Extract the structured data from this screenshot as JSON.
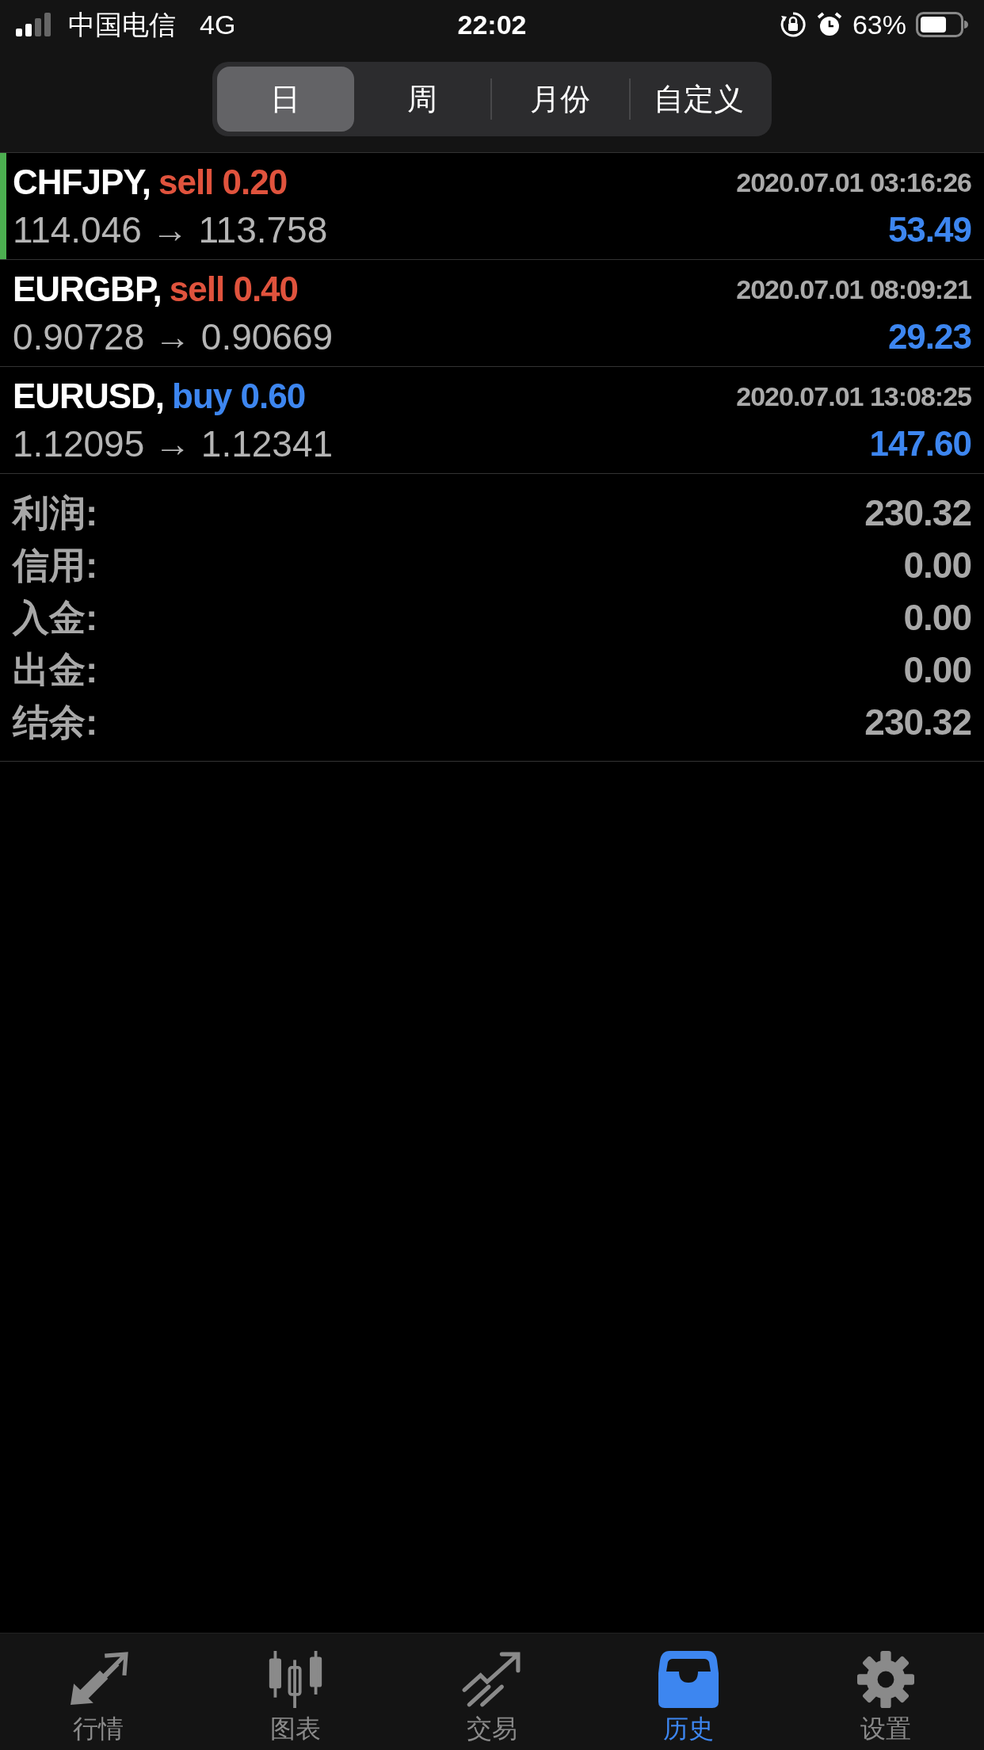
{
  "status_bar": {
    "carrier": "中国电信",
    "network": "4G",
    "time": "22:02",
    "battery": "63%"
  },
  "periods": [
    {
      "label": "日",
      "selected": true
    },
    {
      "label": "周",
      "selected": false
    },
    {
      "label": "月份",
      "selected": false
    },
    {
      "label": "自定义",
      "selected": false
    }
  ],
  "deals": [
    {
      "symbol": "CHFJPY,",
      "kind": "sell",
      "order": "sell 0.20",
      "time": "2020.07.01 03:16:26",
      "prices": "114.046 → 113.758",
      "profit": "53.49",
      "selected": true
    },
    {
      "symbol": "EURGBP,",
      "kind": "sell",
      "order": "sell 0.40",
      "time": "2020.07.01 08:09:21",
      "prices": "0.90728 → 0.90669",
      "profit": "29.23",
      "selected": false
    },
    {
      "symbol": "EURUSD,",
      "kind": "buy",
      "order": "buy 0.60",
      "time": "2020.07.01 13:08:25",
      "prices": "1.12095 → 1.12341",
      "profit": "147.60",
      "selected": false
    }
  ],
  "summary": [
    {
      "label": "利润:",
      "value": "230.32"
    },
    {
      "label": "信用:",
      "value": "0.00"
    },
    {
      "label": "入金:",
      "value": "0.00"
    },
    {
      "label": "出金:",
      "value": "0.00"
    },
    {
      "label": "结余:",
      "value": "230.32"
    }
  ],
  "tab_bar": [
    {
      "label": "行情",
      "kind": "quotes",
      "selected": false
    },
    {
      "label": "图表",
      "kind": "chart",
      "selected": false
    },
    {
      "label": "交易",
      "kind": "trade",
      "selected": false
    },
    {
      "label": "历史",
      "kind": "history",
      "selected": true
    },
    {
      "label": "设置",
      "kind": "settings",
      "selected": false
    }
  ]
}
